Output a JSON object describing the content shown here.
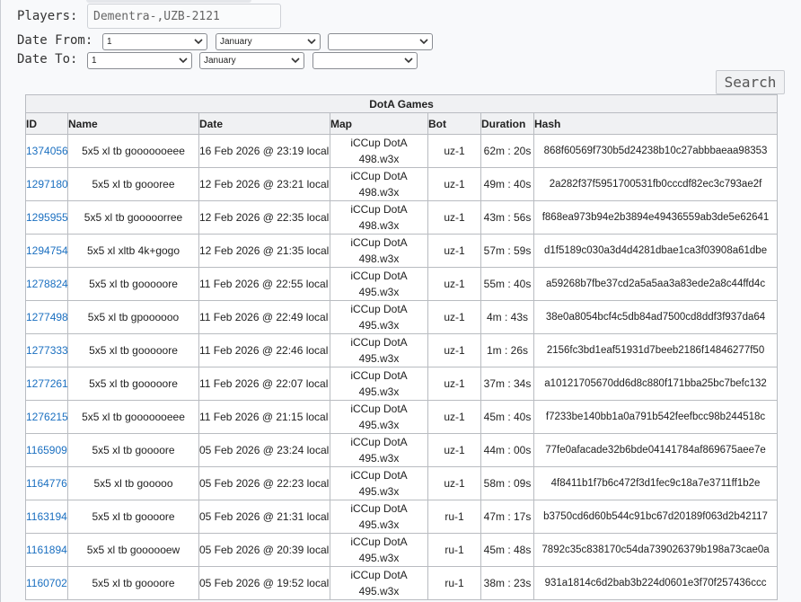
{
  "filters": {
    "players_label": "Players:",
    "players_value": "Dementra-,UZB-2121",
    "date_from_label": "Date From:",
    "date_to_label": "Date To:",
    "from": {
      "day": "1",
      "month": "January",
      "year": ""
    },
    "to": {
      "day": "1",
      "month": "January",
      "year": ""
    },
    "search_label": "Search"
  },
  "table": {
    "caption": "DotA Games",
    "columns": [
      "ID",
      "Name",
      "Date",
      "Map",
      "Bot",
      "Duration",
      "Hash"
    ],
    "rows": [
      {
        "id": "1374056",
        "name": "5x5 xl tb gooooooeee",
        "date": "16 Feb 2026 @ 23:19 local",
        "map1": "iCCup DotA",
        "map2": "498.w3x",
        "bot": "uz-1",
        "duration": "62m : 20s",
        "hash": "868f60569f730b5d24238b10c27abbbaeaa98353"
      },
      {
        "id": "1297180",
        "name": "5x5 xl tb goooree",
        "date": "12 Feb 2026 @ 23:21 local",
        "map1": "iCCup DotA",
        "map2": "498.w3x",
        "bot": "uz-1",
        "duration": "49m : 40s",
        "hash": "2a282f37f5951700531fb0cccdf82ec3c793ae2f"
      },
      {
        "id": "1295955",
        "name": "5x5 xl tb gooooorree",
        "date": "12 Feb 2026 @ 22:35 local",
        "map1": "iCCup DotA",
        "map2": "498.w3x",
        "bot": "uz-1",
        "duration": "43m : 56s",
        "hash": "f868ea973b94e2b3894e49436559ab3de5e62641"
      },
      {
        "id": "1294754",
        "name": "5x5 xl xltb 4k+gogo",
        "date": "12 Feb 2026 @ 21:35 local",
        "map1": "iCCup DotA",
        "map2": "498.w3x",
        "bot": "uz-1",
        "duration": "57m : 59s",
        "hash": "d1f5189c030a3d4d4281dbae1ca3f03908a61dbe"
      },
      {
        "id": "1278824",
        "name": "5x5 xl tb gooooore",
        "date": "11 Feb 2026 @ 22:55 local",
        "map1": "iCCup DotA",
        "map2": "495.w3x",
        "bot": "uz-1",
        "duration": "55m : 40s",
        "hash": "a59268b7fbe37cd2a5a5aa3a83ede2a8c44ffd4c"
      },
      {
        "id": "1277498",
        "name": "5x5 xl tb gpoooooo",
        "date": "11 Feb 2026 @ 22:49 local",
        "map1": "iCCup DotA",
        "map2": "495.w3x",
        "bot": "uz-1",
        "duration": "4m : 43s",
        "hash": "38e0a8054bcf4c5db84ad7500cd8ddf3f937da64"
      },
      {
        "id": "1277333",
        "name": "5x5 xl tb gooooore",
        "date": "11 Feb 2026 @ 22:46 local",
        "map1": "iCCup DotA",
        "map2": "495.w3x",
        "bot": "uz-1",
        "duration": "1m : 26s",
        "hash": "2156fc3bd1eaf51931d7beeb2186f14846277f50"
      },
      {
        "id": "1277261",
        "name": "5x5 xl tb gooooore",
        "date": "11 Feb 2026 @ 22:07 local",
        "map1": "iCCup DotA",
        "map2": "495.w3x",
        "bot": "uz-1",
        "duration": "37m : 34s",
        "hash": "a10121705670dd6d8c880f171bba25bc7befc132"
      },
      {
        "id": "1276215",
        "name": "5x5 xl tb gooooooeee",
        "date": "11 Feb 2026 @ 21:15 local",
        "map1": "iCCup DotA",
        "map2": "495.w3x",
        "bot": "uz-1",
        "duration": "45m : 40s",
        "hash": "f7233be140bb1a0a791b542feefbcc98b244518c"
      },
      {
        "id": "1165909",
        "name": "5x5 xl tb goooore",
        "date": "05 Feb 2026 @ 23:24 local",
        "map1": "iCCup DotA",
        "map2": "495.w3x",
        "bot": "uz-1",
        "duration": "44m : 00s",
        "hash": "77fe0afacade32b6bde04141784af869675aee7e"
      },
      {
        "id": "1164776",
        "name": "5x5 xl tb gooooo",
        "date": "05 Feb 2026 @ 22:23 local",
        "map1": "iCCup DotA",
        "map2": "495.w3x",
        "bot": "uz-1",
        "duration": "58m : 09s",
        "hash": "4f8411b1f7b6c472f3d1fec9c18a7e3711ff1b2e"
      },
      {
        "id": "1163194",
        "name": "5x5 xl tb goooore",
        "date": "05 Feb 2026 @ 21:31 local",
        "map1": "iCCup DotA",
        "map2": "495.w3x",
        "bot": "ru-1",
        "duration": "47m : 17s",
        "hash": "b3750cd6d60b544c91bc67d20189f063d2b42117"
      },
      {
        "id": "1161894",
        "name": "5x5 xl tb goooooew",
        "date": "05 Feb 2026 @ 20:39 local",
        "map1": "iCCup DotA",
        "map2": "495.w3x",
        "bot": "ru-1",
        "duration": "45m : 48s",
        "hash": "7892c35c838170c54da739026379b198a73cae0a"
      },
      {
        "id": "1160702",
        "name": "5x5 xl tb goooore",
        "date": "05 Feb 2026 @ 19:52 local",
        "map1": "iCCup DotA",
        "map2": "495.w3x",
        "bot": "ru-1",
        "duration": "38m : 23s",
        "hash": "931a1814c6d2bab3b224d0601e3f70f257436ccc"
      }
    ]
  }
}
